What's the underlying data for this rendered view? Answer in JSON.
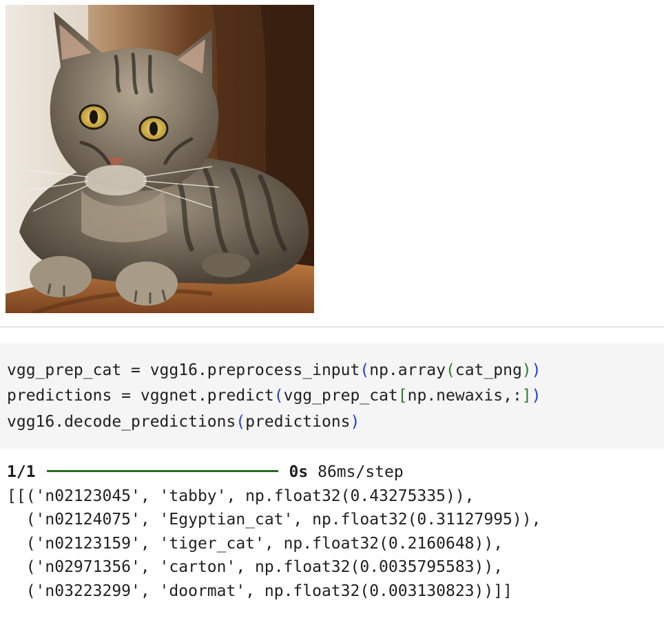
{
  "image_output": {
    "subject_icon": "tabby-cat-photo"
  },
  "code_cell": {
    "line1": {
      "a": "vgg_prep_cat = vgg16.preprocess_input",
      "p_open": "(",
      "b": "np.array",
      "p2_open": "(",
      "c": "cat_png",
      "p2_close": ")",
      "p_close": ")"
    },
    "line2": {
      "a": "predictions = vggnet.predict",
      "p_open": "(",
      "b": "vgg_prep_cat",
      "br_open": "[",
      "c": "np.newaxis,:",
      "br_close": "]",
      "p_close": ")"
    },
    "line3": {
      "a": "vgg16.decode_predictions",
      "p_open": "(",
      "b": "predictions",
      "p_close": ")"
    }
  },
  "output": {
    "progress": {
      "step_count": "1/1",
      "fill_fraction": 1.0,
      "elapsed": "0s",
      "rate": "86ms/step"
    },
    "lines": [
      "[[('n02123045', 'tabby', np.float32(0.43275335)),",
      "  ('n02124075', 'Egyptian_cat', np.float32(0.31127995)),",
      "  ('n02123159', 'tiger_cat', np.float32(0.2160648)),",
      "  ('n02971356', 'carton', np.float32(0.0035795583)),",
      "  ('n03223299', 'doormat', np.float32(0.003130823))]]"
    ]
  },
  "colors": {
    "bracket_level1": "#1e3fd6",
    "bracket_level2": "#2f7d32",
    "progress_bar": "#2a6a23",
    "code_background": "#f5f5f5"
  }
}
